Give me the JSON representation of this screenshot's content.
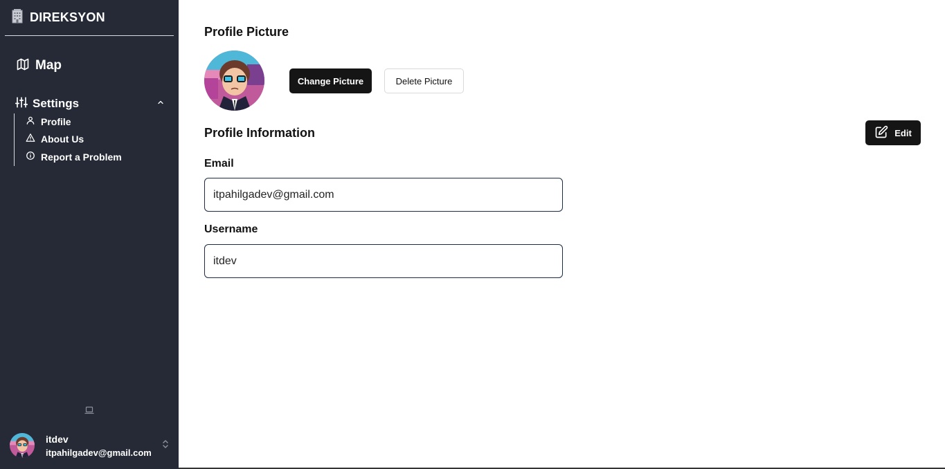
{
  "app": {
    "brand": "DIREKSYON",
    "brand_icon": "building-icon"
  },
  "sidebar": {
    "map_label": "Map",
    "settings_label": "Settings",
    "settings_expanded": true,
    "sub_items": [
      {
        "label": "Profile",
        "icon": "user-icon"
      },
      {
        "label": "About Us",
        "icon": "warning-triangle-icon"
      },
      {
        "label": "Report a Problem",
        "icon": "info-circle-icon"
      }
    ]
  },
  "user": {
    "name": "itdev",
    "email": "itpahilgadev@gmail.com"
  },
  "profile": {
    "picture_heading": "Profile Picture",
    "change_picture_label": "Change Picture",
    "delete_picture_label": "Delete Picture",
    "info_heading": "Profile Information",
    "edit_label": "Edit",
    "email_label": "Email",
    "email_value": "itpahilgadev@gmail.com",
    "username_label": "Username",
    "username_value": "itdev"
  },
  "colors": {
    "sidebar_bg": "#252a36",
    "primary_button": "#151515",
    "input_border": "#1c2a44"
  }
}
